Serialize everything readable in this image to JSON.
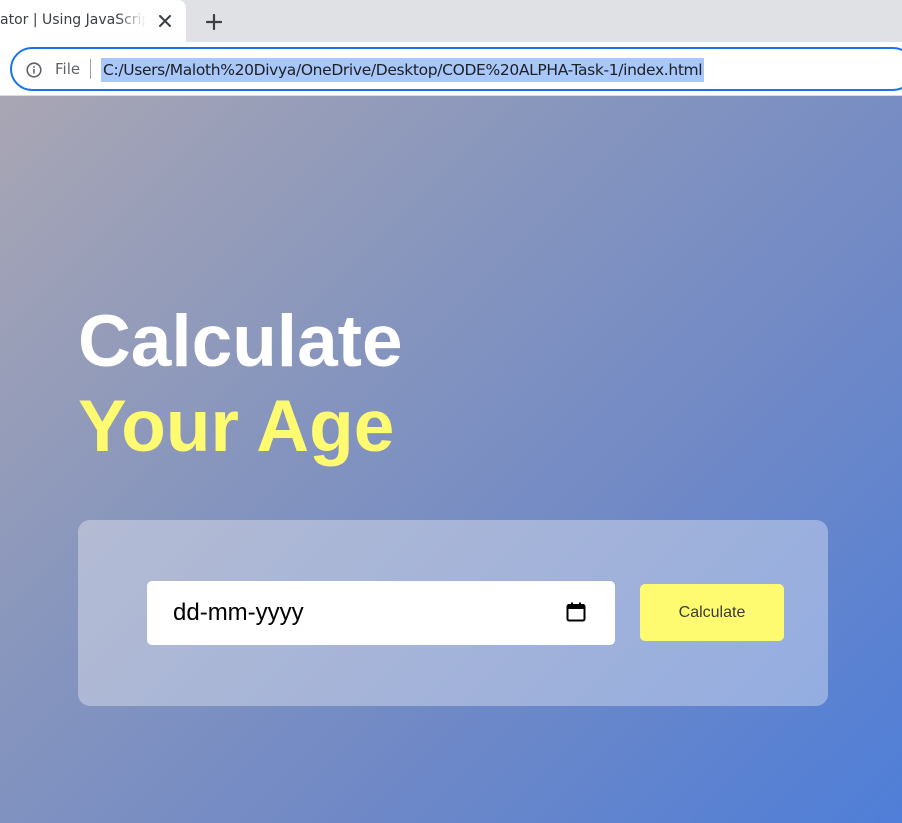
{
  "browser": {
    "tab": {
      "title": "ator | Using JavaScript"
    },
    "address_bar": {
      "scheme_label": "File",
      "url": "C:/Users/Maloth%20Divya/OneDrive/Desktop/CODE%20ALPHA-Task-1/index.html"
    },
    "icons": [
      "info-icon",
      "close-icon",
      "plus-icon",
      "calendar-icon"
    ]
  },
  "page": {
    "heading_line1": "Calculate",
    "heading_line2": "Your Age",
    "date_input": {
      "placeholder": "dd-mm-yyyy"
    },
    "calculate_button": "Calculate"
  },
  "colors": {
    "accent_yellow": "#fffb70",
    "background_start": "#a9a6b4",
    "background_end": "#4f7ed8",
    "omnibox_focus": "#1a73e8",
    "url_selection": "#a8c7fa"
  }
}
